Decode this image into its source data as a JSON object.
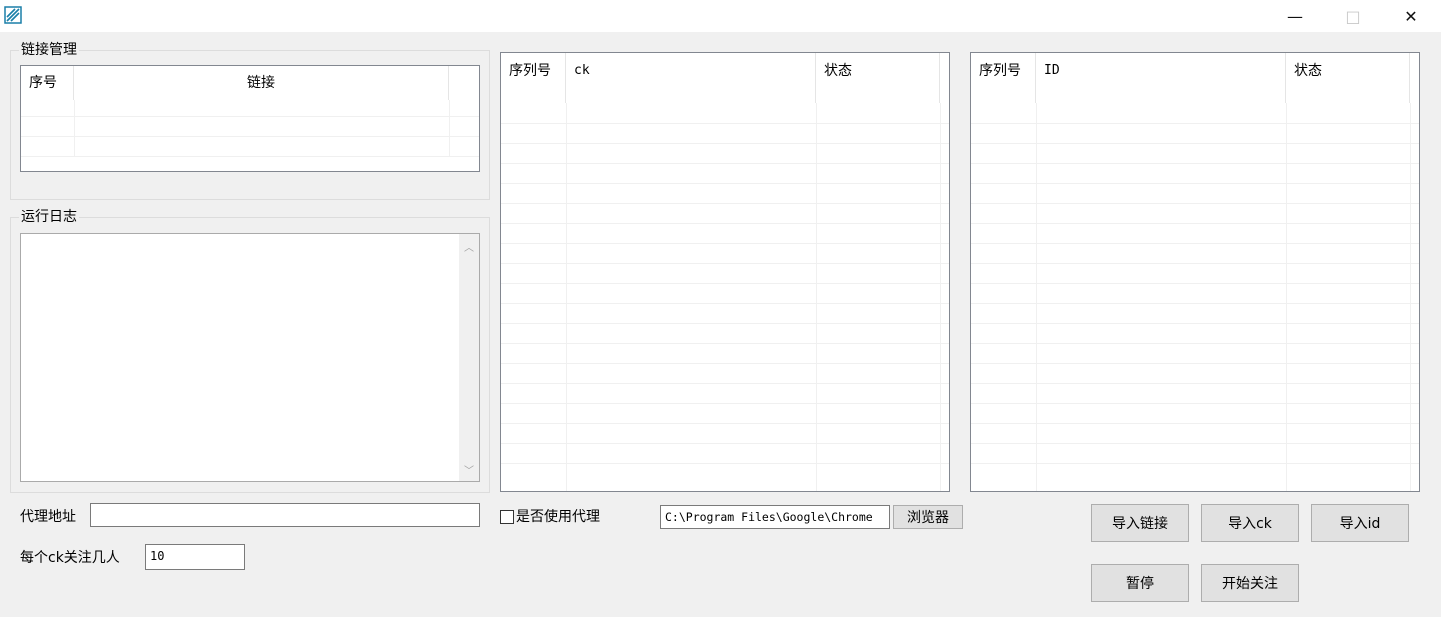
{
  "window": {
    "minimize": "—",
    "maximize": "□",
    "close": "✕"
  },
  "link_group": {
    "title": "链接管理",
    "columns": [
      "序号",
      "链接"
    ]
  },
  "log_group": {
    "title": "运行日志"
  },
  "proxy": {
    "label": "代理地址",
    "value": "",
    "use_proxy_label": "是否使用代理"
  },
  "follow_count": {
    "label": "每个ck关注几人",
    "value": "10"
  },
  "ck_table": {
    "columns": [
      "序列号",
      "ck",
      "状态"
    ]
  },
  "id_table": {
    "columns": [
      "序列号",
      "ID",
      "状态"
    ]
  },
  "browser": {
    "path": "C:\\Program Files\\Google\\Chrome",
    "button": "浏览器"
  },
  "buttons": {
    "import_link": "导入链接",
    "import_ck": "导入ck",
    "import_id": "导入id",
    "pause": "暂停",
    "start_follow": "开始关注"
  }
}
